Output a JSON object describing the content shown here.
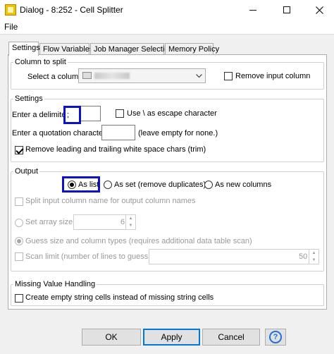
{
  "window": {
    "title": "Dialog - 8:252 - Cell Splitter",
    "icons": {
      "app": "knime-node-icon",
      "minimize": "minimize-icon",
      "maximize": "maximize-icon",
      "close": "close-icon"
    }
  },
  "menu": {
    "file": "File"
  },
  "tabs": [
    {
      "label": "Settings",
      "active": true
    },
    {
      "label": "Flow Variables"
    },
    {
      "label": "Job Manager Selection"
    },
    {
      "label": "Memory Policy"
    }
  ],
  "column_to_split": {
    "legend": "Column to split",
    "select_label": "Select a column:",
    "remove_input_label": "Remove input column",
    "remove_input_checked": false
  },
  "settings": {
    "legend": "Settings",
    "delimiter_label": "Enter a delimiter:",
    "delimiter_value": ";",
    "escape_label": "Use \\ as escape character",
    "escape_checked": false,
    "quote_label": "Enter a quotation character:",
    "quote_value": "",
    "quote_hint": "(leave empty for none.)",
    "trim_label": "Remove leading and trailing white space chars (trim)",
    "trim_checked": true
  },
  "output": {
    "legend": "Output",
    "options": [
      "As list",
      "As set (remove duplicates)",
      "As new columns"
    ],
    "selected": "As list",
    "split_names_label": "Split input column name for output column names",
    "array_size_label": "Set array size",
    "array_size_value": "6",
    "guess_label": "Guess size and column types (requires additional data table scan)",
    "scan_limit_label": "Scan limit (number of lines to guess on)",
    "scan_limit_value": "50"
  },
  "missing": {
    "legend": "Missing Value Handling",
    "empty_cells_label": "Create empty string cells instead of missing string cells"
  },
  "buttons": {
    "ok": "OK",
    "apply": "Apply",
    "cancel": "Cancel",
    "help": "?"
  },
  "colors": {
    "highlight": "#0b12c8",
    "help_blue": "#1e6fd9",
    "panel_bg": "#f0f0f0"
  }
}
